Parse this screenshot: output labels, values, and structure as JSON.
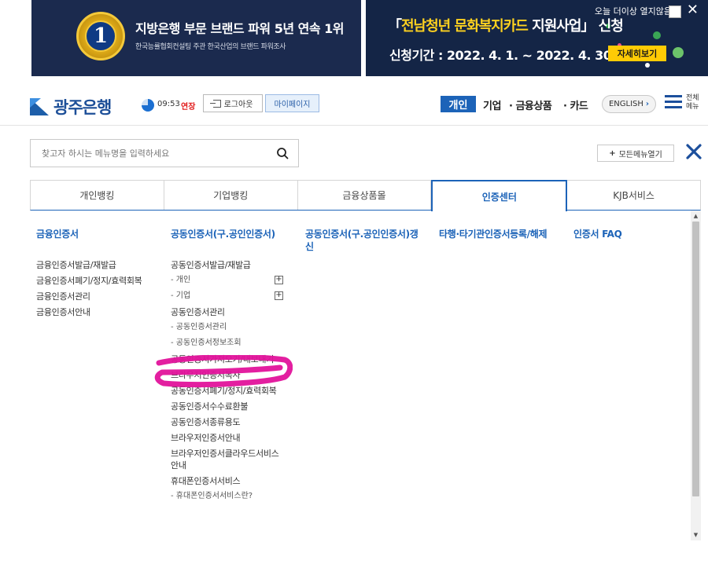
{
  "banner_left": {
    "medal_number": "1",
    "headline": "지방은행 부문 브랜드 파워 5년 연속 1위",
    "subline": "한국능률협회컨설팅 주관 한국산업의 브랜드 파워조사"
  },
  "banner_right": {
    "promo_open": "「",
    "promo_highlight": "전남청년 문화복지카드",
    "promo_mid": " 지원사업",
    "promo_close": "」 신청",
    "period": "신청기간 : 2022. 4. 1. ~ 2022. 4. 30.",
    "detail_button": "자세히보기",
    "hide_today_label": "오늘 더이상 열지않음",
    "close_glyph": "✕"
  },
  "header": {
    "logo_text": "광주은행",
    "timer": "09:53",
    "extend_label": "연장",
    "logout_label": "로그아웃",
    "mypage_label": "마이페이지",
    "category_active": "개인",
    "category_links": [
      "기업",
      "· 금융상품",
      "· 카드"
    ],
    "english_label": "ENGLISH",
    "english_chevron": "›",
    "allmenu_label": "전체 메뉴"
  },
  "search": {
    "placeholder": "찾고자 하시는 메뉴명을 입력하세요",
    "value": ""
  },
  "open_all_label": "모든메뉴열기",
  "tabs": [
    {
      "label": "개인뱅킹",
      "active": false
    },
    {
      "label": "기업뱅킹",
      "active": false
    },
    {
      "label": "금융상품몰",
      "active": false
    },
    {
      "label": "인증센터",
      "active": true
    },
    {
      "label": "KJB서비스",
      "active": false
    }
  ],
  "menu": {
    "col1": {
      "title": "금융인증서",
      "items": [
        "금융인증서발급/재발급",
        "금융인증서폐기/정지/효력회복",
        "금융인증서관리",
        "금융인증서안내"
      ]
    },
    "col2": {
      "title": "공동인증서(구.공인인증서)",
      "item_issue": "공동인증서발급/재발급",
      "sub_personal": "- 개인",
      "sub_corporate": "- 기업",
      "expand_glyph": "+",
      "item_manage": "공동인증서관리",
      "sub_manage": "- 공동인증서관리",
      "sub_info": "- 공동인증서정보조회",
      "item_export": "공동인증서가져오기/내보내기",
      "items_rest": [
        "브라우저인증서복사",
        "공동인증서폐기/정지/효력회복",
        "공동인증서수수료환불",
        "공동인증서종류용도",
        "브라우저인증서안내",
        "브라우저인증서클라우드서비스안내",
        "휴대폰인증서서비스"
      ],
      "sub_mobile": "- 휴대폰인증서서비스란?"
    },
    "col3": {
      "title": "공동인증서(구.공인인증서)갱신"
    },
    "col4": {
      "title": "타행·타기관인증서등록/해제"
    },
    "col5": {
      "title": "인증서 FAQ"
    }
  },
  "scrollbar": {
    "up_glyph": "▲",
    "down_glyph": "▼"
  },
  "colors": {
    "brand_blue": "#1c63b8",
    "banner_navy": "#1b2a4e",
    "promo_yellow": "#ffd21f",
    "highlight_magenta": "#e2139b"
  }
}
